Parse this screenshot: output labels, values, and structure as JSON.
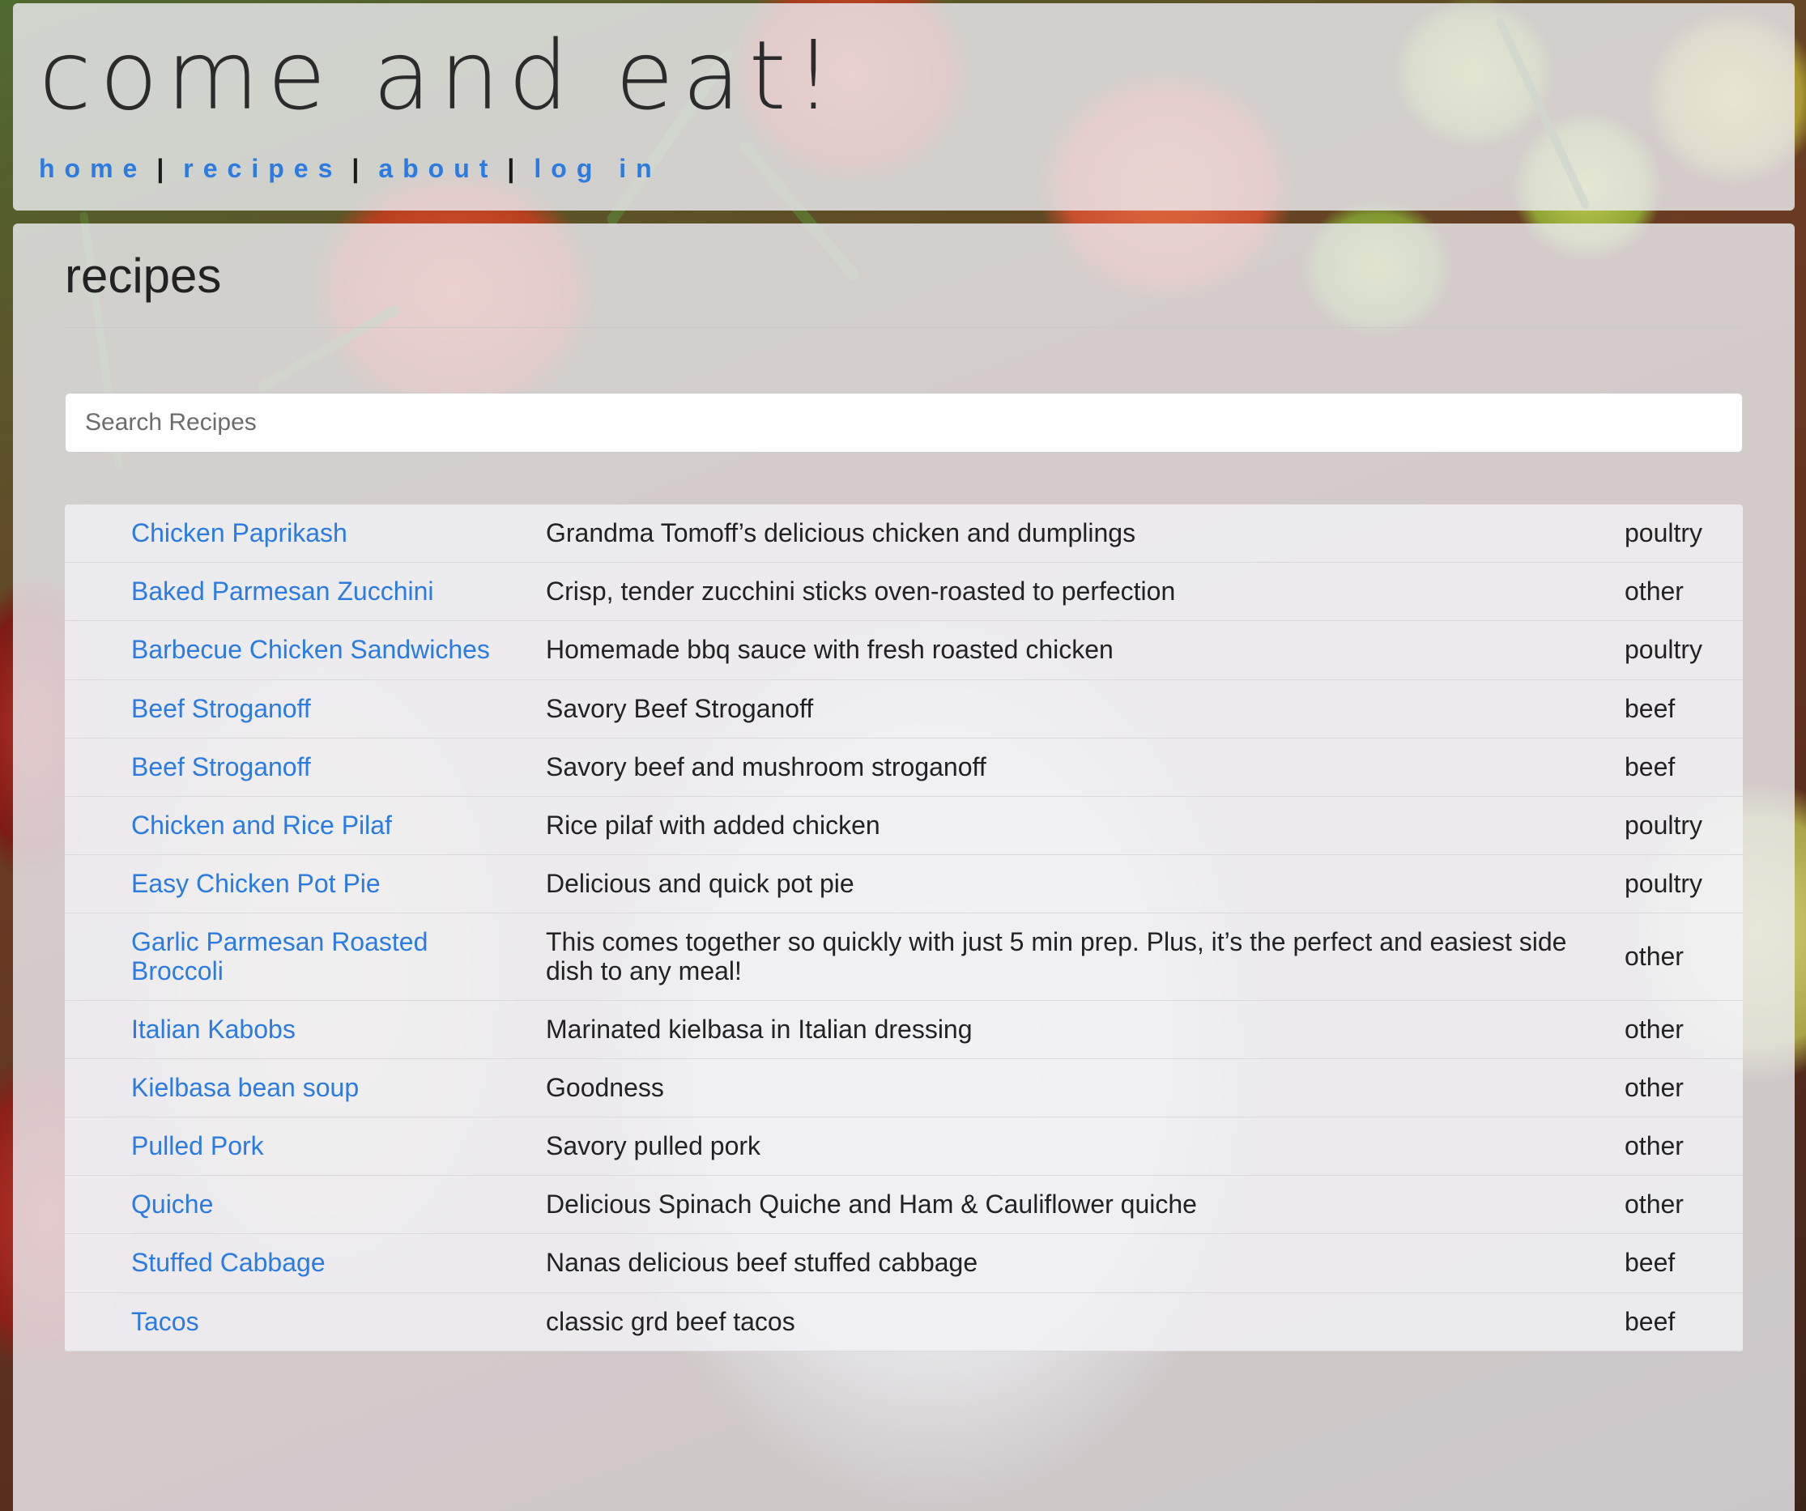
{
  "site": {
    "title": "come and eat!"
  },
  "nav": {
    "items": [
      "home",
      "recipes",
      "about",
      "log in"
    ],
    "separator": "|"
  },
  "page": {
    "title": "recipes"
  },
  "search": {
    "placeholder": "Search Recipes",
    "value": ""
  },
  "recipes": [
    {
      "name": "Chicken Paprikash",
      "description": "Grandma Tomoff’s delicious chicken and dumplings",
      "category": "poultry"
    },
    {
      "name": "Baked Parmesan Zucchini",
      "description": "Crisp, tender zucchini sticks oven-roasted to perfection",
      "category": "other"
    },
    {
      "name": "Barbecue Chicken Sandwiches",
      "description": "Homemade bbq sauce with fresh roasted chicken",
      "category": "poultry"
    },
    {
      "name": "Beef Stroganoff",
      "description": "Savory Beef Stroganoff",
      "category": "beef"
    },
    {
      "name": "Beef Stroganoff",
      "description": "Savory beef and mushroom stroganoff",
      "category": "beef"
    },
    {
      "name": "Chicken and Rice Pilaf",
      "description": "Rice pilaf with added chicken",
      "category": "poultry"
    },
    {
      "name": "Easy Chicken Pot Pie",
      "description": "Delicious and quick pot pie",
      "category": "poultry"
    },
    {
      "name": "Garlic Parmesan Roasted Broccoli",
      "description": "This comes together so quickly with just 5 min prep. Plus, it’s the perfect and easiest side dish to any meal!",
      "category": "other"
    },
    {
      "name": "Italian Kabobs",
      "description": "Marinated kielbasa in Italian dressing",
      "category": "other"
    },
    {
      "name": "Kielbasa bean soup",
      "description": "Goodness",
      "category": "other"
    },
    {
      "name": "Pulled Pork",
      "description": "Savory pulled pork",
      "category": "other"
    },
    {
      "name": "Quiche",
      "description": "Delicious Spinach Quiche and Ham & Cauliflower quiche",
      "category": "other"
    },
    {
      "name": "Stuffed Cabbage",
      "description": "Nanas delicious beef stuffed cabbage",
      "category": "beef"
    },
    {
      "name": "Tacos",
      "description": "classic grd beef tacos",
      "category": "beef"
    }
  ]
}
